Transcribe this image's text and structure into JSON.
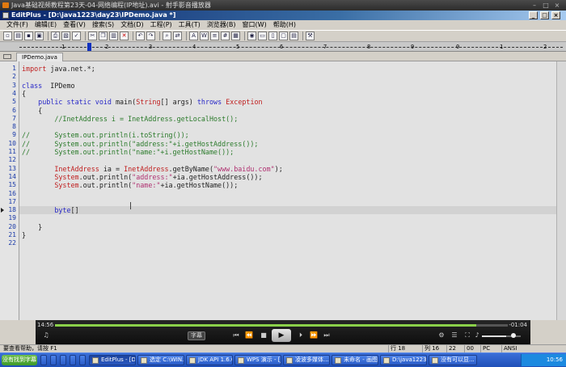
{
  "player": {
    "title": "Java基础视频教程第23天-04-网络编程(IP地址).avi - 射手影音播放器",
    "time_elapsed": "14:56",
    "time_remaining": "-01:04",
    "progress": 0.93,
    "subtitle_button": "字幕",
    "volume": 0.62
  },
  "editor": {
    "title": "EditPlus - [D:\\java1223\\day23\\IPDemo.java *]",
    "menu": [
      "文件(F)",
      "编辑(E)",
      "查看(V)",
      "搜索(S)",
      "文档(D)",
      "工程(P)",
      "工具(T)",
      "浏览器(B)",
      "窗口(W)",
      "帮助(H)"
    ],
    "ruler_labels": [
      "1",
      "2",
      "3",
      "4",
      "5",
      "6",
      "7",
      "8",
      "9",
      "0",
      "1",
      "2"
    ],
    "file_tab": "IPDemo.java",
    "current_line": 18,
    "lines": [
      [
        {
          "t": "import",
          "c": "ty"
        },
        {
          "t": " java.net.*;",
          "c": ""
        }
      ],
      [],
      [
        {
          "t": "class",
          "c": "kw"
        },
        {
          "t": "  IPDemo",
          "c": ""
        }
      ],
      [
        {
          "t": "{",
          "c": ""
        }
      ],
      [
        {
          "t": "    ",
          "c": ""
        },
        {
          "t": "public",
          "c": "kw"
        },
        {
          "t": " ",
          "c": ""
        },
        {
          "t": "static",
          "c": "kw"
        },
        {
          "t": " ",
          "c": ""
        },
        {
          "t": "void",
          "c": "kw"
        },
        {
          "t": " main(",
          "c": ""
        },
        {
          "t": "String",
          "c": "ty"
        },
        {
          "t": "[] args) ",
          "c": ""
        },
        {
          "t": "throws",
          "c": "kw"
        },
        {
          "t": " ",
          "c": ""
        },
        {
          "t": "Exception",
          "c": "ty"
        }
      ],
      [
        {
          "t": "    {",
          "c": ""
        }
      ],
      [
        {
          "t": "        //InetAddress i = InetAddress.getLocalHost();",
          "c": "cm"
        }
      ],
      [],
      [
        {
          "t": "//      System.out.println(i.toString());",
          "c": "cm"
        }
      ],
      [
        {
          "t": "//      System.out.println(\"address:\"+i.getHostAddress());",
          "c": "cm"
        }
      ],
      [
        {
          "t": "//      System.out.println(\"name:\"+i.getHostName());",
          "c": "cm"
        }
      ],
      [],
      [
        {
          "t": "        ",
          "c": ""
        },
        {
          "t": "InetAddress",
          "c": "ty"
        },
        {
          "t": " ia = ",
          "c": ""
        },
        {
          "t": "InetAddress",
          "c": "ty"
        },
        {
          "t": ".getByName(",
          "c": ""
        },
        {
          "t": "\"www.baidu.com\"",
          "c": "str"
        },
        {
          "t": ");",
          "c": ""
        }
      ],
      [
        {
          "t": "        ",
          "c": ""
        },
        {
          "t": "System",
          "c": "ty"
        },
        {
          "t": ".out.println(",
          "c": ""
        },
        {
          "t": "\"address:\"",
          "c": "str"
        },
        {
          "t": "+ia.getHostAddress());",
          "c": ""
        }
      ],
      [
        {
          "t": "        ",
          "c": ""
        },
        {
          "t": "System",
          "c": "ty"
        },
        {
          "t": ".out.println(",
          "c": ""
        },
        {
          "t": "\"name:\"",
          "c": "str"
        },
        {
          "t": "+ia.getHostName());",
          "c": ""
        }
      ],
      [],
      [],
      [
        {
          "t": "        ",
          "c": ""
        },
        {
          "t": "byte",
          "c": "kw"
        },
        {
          "t": "[]",
          "c": ""
        }
      ],
      [],
      [
        {
          "t": "    }",
          "c": ""
        }
      ],
      [
        {
          "t": "}",
          "c": ""
        }
      ],
      []
    ]
  },
  "status": {
    "help": "要查看帮助，请按 F1",
    "line": "行 18",
    "col": "列 16",
    "num1": "22",
    "num2": "00",
    "mode": "PC",
    "encoding": "ANSI"
  },
  "taskbar": {
    "start": "没有找到字幕",
    "tasks": [
      "EditPlus - [D:\\j...",
      "选定 C:\\WIN...",
      "JDK API 1.6.0...",
      "WPS 演示 - [J...",
      "凌波多媒体...",
      "未命名 - 画图",
      "D:\\java1223avi",
      "没有可以显..."
    ],
    "clock": "10:56"
  },
  "colors": {
    "editor_bg": "#e2e2e2",
    "line_numbers": "#1a3aa8",
    "keyword": "#2828c8",
    "type": "#c02020",
    "string": "#b03070",
    "comment": "#2a7a2a",
    "progress": "#8bd04a"
  }
}
